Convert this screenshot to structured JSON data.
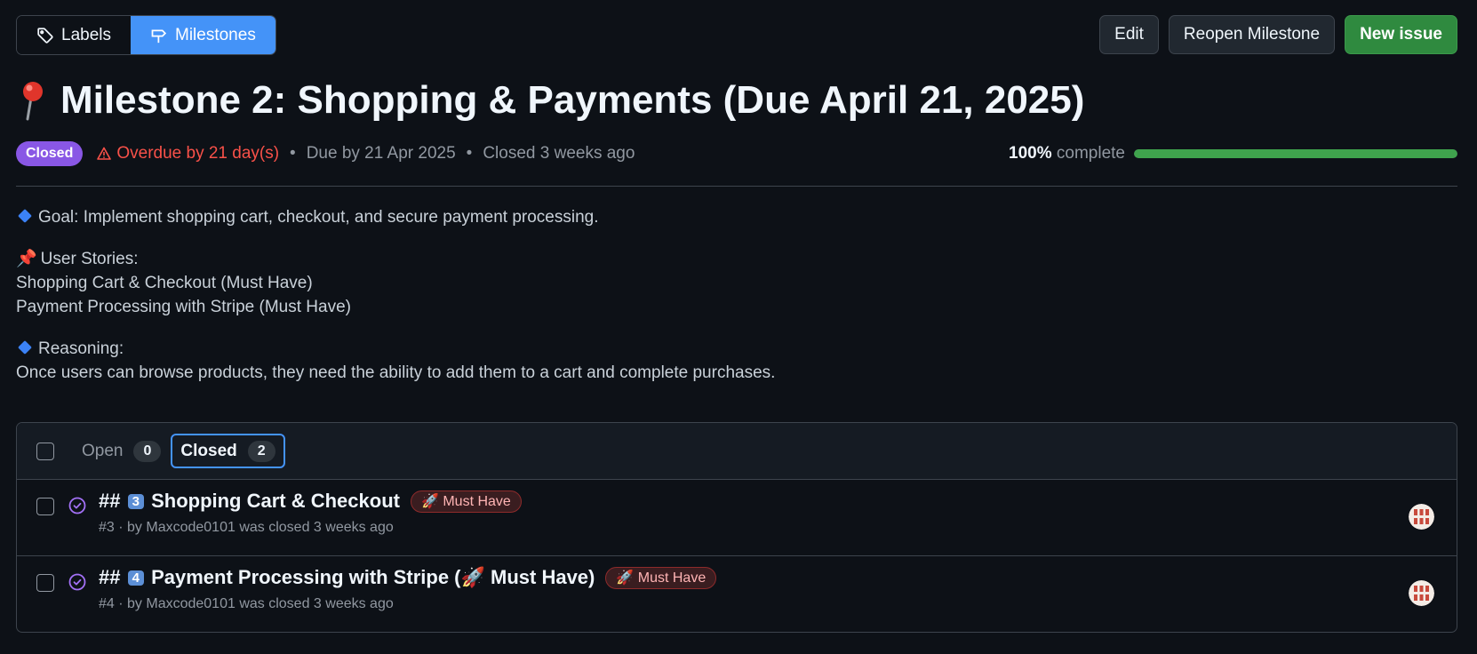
{
  "tabs": {
    "labels": "Labels",
    "milestones": "Milestones"
  },
  "actions": {
    "edit": "Edit",
    "reopen": "Reopen Milestone",
    "new_issue": "New issue"
  },
  "title": "Milestone 2: Shopping & Payments (Due April 21, 2025)",
  "meta": {
    "status": "Closed",
    "overdue": "Overdue by 21 day(s)",
    "due": "Due by 21 Apr 2025",
    "closed": "Closed 3 weeks ago",
    "separator": "•",
    "progress_pct": "100%",
    "progress_label": "complete",
    "progress_value": 1.0
  },
  "description": {
    "goal": "Goal: Implement shopping cart, checkout, and secure payment processing.",
    "stories_heading": "User Stories:",
    "story1": "Shopping Cart & Checkout (Must Have)",
    "story2": "Payment Processing with Stripe (Must Have)",
    "reasoning_heading": "Reasoning:",
    "reasoning_text": "Once users can browse products, they need the ability to add them to a cart and complete purchases."
  },
  "issues_header": {
    "open_label": "Open",
    "open_count": "0",
    "closed_label": "Closed",
    "closed_count": "2"
  },
  "issues": [
    {
      "prefix": "##",
      "keycap": "3",
      "title": "Shopping Cart & Checkout",
      "label": "🚀 Must Have",
      "meta": "#3 · by Maxcode0101 was closed 3 weeks ago"
    },
    {
      "prefix": "##",
      "keycap": "4",
      "title": "Payment Processing with Stripe (🚀 Must Have)",
      "label": "🚀 Must Have",
      "meta": "#4 · by Maxcode0101 was closed 3 weeks ago"
    }
  ],
  "colors": {
    "accent": "#4493f8",
    "closed_purple": "#8957e5",
    "progress_green": "#3fa34d",
    "danger": "#f85149"
  }
}
